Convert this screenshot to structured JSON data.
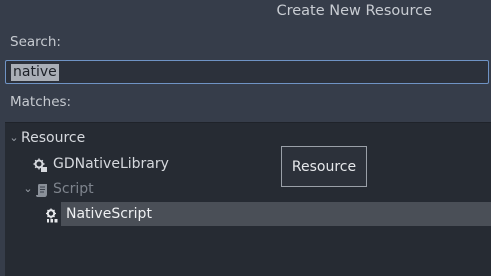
{
  "dialog": {
    "title": "Create New Resource"
  },
  "search": {
    "label": "Search:",
    "value": "native"
  },
  "matches": {
    "label": "Matches:"
  },
  "tree": {
    "root": {
      "label": "Resource",
      "expanded": true
    },
    "items": [
      {
        "label": "GDNativeLibrary",
        "icon": "gdnative-library-icon"
      },
      {
        "label": "Script",
        "icon": "script-icon",
        "expanded": true,
        "disabled": true
      },
      {
        "label": "NativeScript",
        "icon": "nativescript-icon",
        "selected": true
      }
    ]
  },
  "tooltip": {
    "text": "Resource"
  },
  "colors": {
    "background": "#363d4a",
    "tree_background": "#262b33",
    "selection": "#4a4f57",
    "focus_border": "#6f93c4"
  }
}
